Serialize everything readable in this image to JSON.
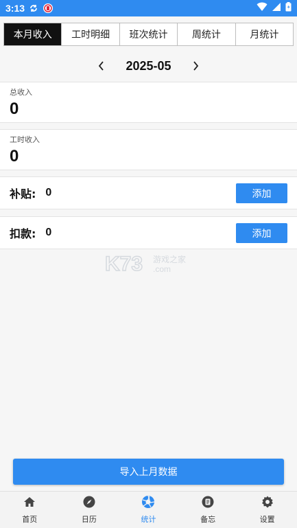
{
  "status_bar": {
    "time": "3:13"
  },
  "tabs": [
    {
      "label": "本月收入",
      "active": true
    },
    {
      "label": "工时明细",
      "active": false
    },
    {
      "label": "班次统计",
      "active": false
    },
    {
      "label": "周统计",
      "active": false
    },
    {
      "label": "月统计",
      "active": false
    }
  ],
  "month": "2025-05",
  "total_income": {
    "label": "总收入",
    "value": "0"
  },
  "hours_income": {
    "label": "工时收入",
    "value": "0"
  },
  "subsidy": {
    "label": "补贴:",
    "value": "0",
    "button": "添加"
  },
  "deduction": {
    "label": "扣款:",
    "value": "0",
    "button": "添加"
  },
  "watermark": {
    "logo": "K73",
    "text": "游戏之家",
    "domain": ".com"
  },
  "import_button": "导入上月数据",
  "nav": [
    {
      "label": "首页",
      "icon": "home-icon",
      "active": false
    },
    {
      "label": "日历",
      "icon": "compass-icon",
      "active": false
    },
    {
      "label": "统计",
      "icon": "aperture-icon",
      "active": true
    },
    {
      "label": "备忘",
      "icon": "memo-icon",
      "active": false
    },
    {
      "label": "设置",
      "icon": "gear-icon",
      "active": false
    }
  ],
  "colors": {
    "accent": "#2f8bf0",
    "active_tab": "#111111"
  }
}
